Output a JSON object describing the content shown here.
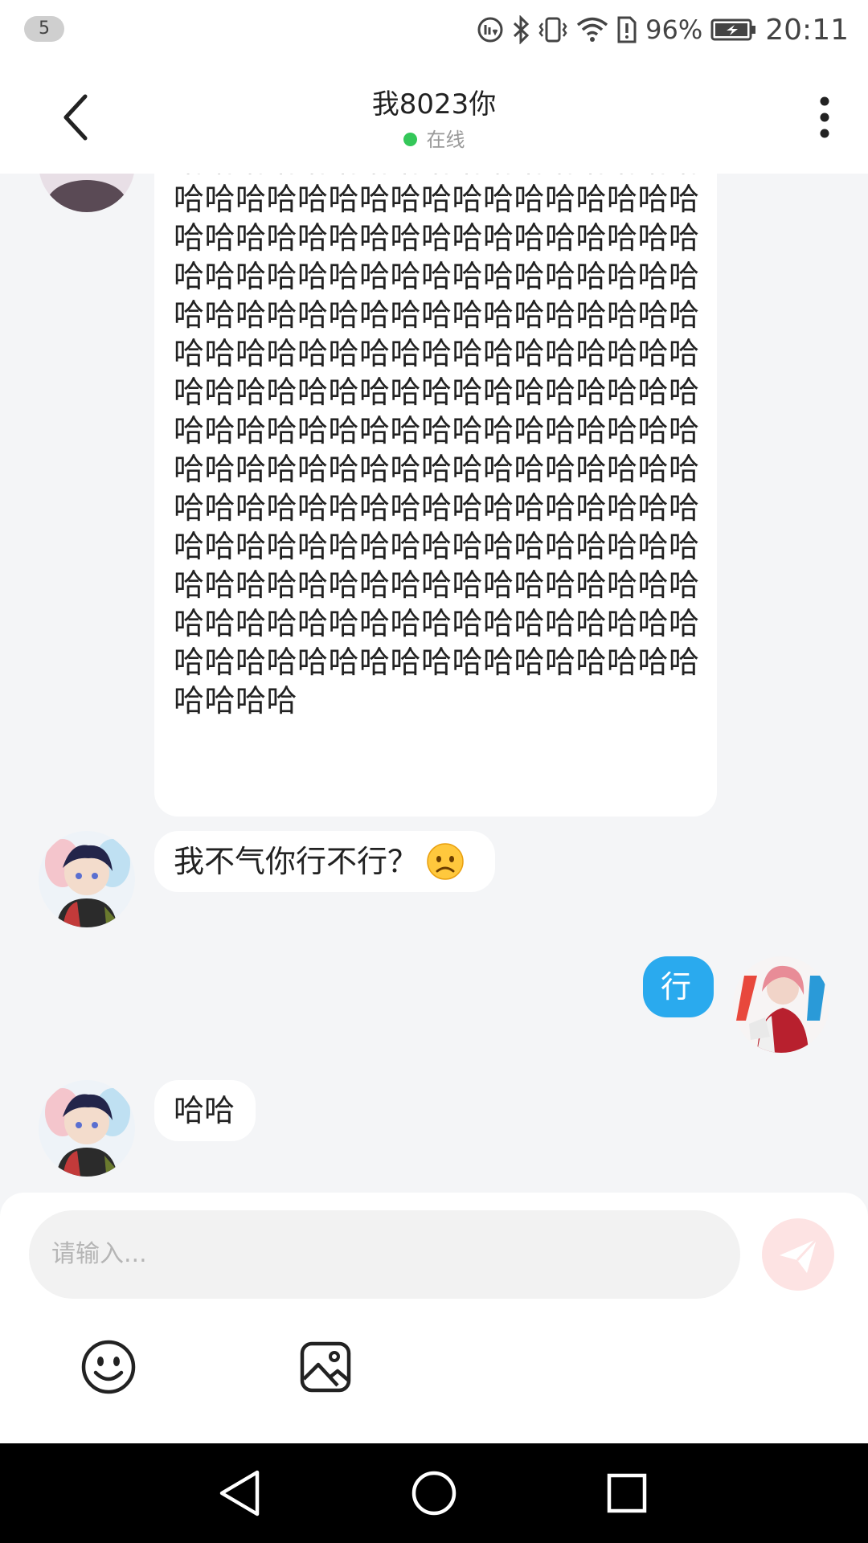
{
  "status_bar": {
    "notification_count": "5",
    "battery_percent": "96%",
    "time": "20:11"
  },
  "header": {
    "title": "我8023你",
    "status": "在线",
    "status_color": "#34c759"
  },
  "messages": [
    {
      "side": "left",
      "text": "哈哈哈哈哈哈哈哈哈哈哈哈哈哈哈哈哈哈哈哈哈哈哈哈哈哈哈哈哈哈哈哈哈哈哈哈哈哈哈哈哈哈哈哈哈哈哈哈哈哈哈哈哈哈哈哈哈哈哈哈哈哈哈哈哈哈哈哈哈哈哈哈哈哈哈哈哈哈哈哈哈哈哈哈哈哈哈哈哈哈哈哈哈哈哈哈哈哈哈哈哈哈哈哈哈哈哈哈哈哈哈哈哈哈哈哈哈哈哈哈哈哈哈哈哈哈哈哈哈哈哈哈哈哈哈哈哈哈哈哈哈哈哈哈哈哈哈哈哈哈哈哈哈哈哈哈哈哈哈哈哈哈哈哈哈哈哈哈哈哈哈哈哈哈哈哈哈哈哈哈哈哈哈哈哈哈哈哈哈哈哈哈哈哈哈哈哈哈哈哈哈哈哈哈哈哈哈哈哈哈哈哈哈哈哈哈哈哈哈哈哈哈哈哈哈哈哈哈哈哈哈哈哈哈哈哈哈哈哈哈哈哈"
    },
    {
      "side": "left",
      "text": "我不气你行不行？",
      "emoji": "worried-face"
    },
    {
      "side": "right",
      "text": "行"
    },
    {
      "side": "left",
      "text": "哈哈"
    }
  ],
  "composer": {
    "placeholder": "请输入..."
  },
  "colors": {
    "self_bubble": "#2aaaee",
    "other_bubble": "#ffffff",
    "send_button": "#fde3e3"
  }
}
